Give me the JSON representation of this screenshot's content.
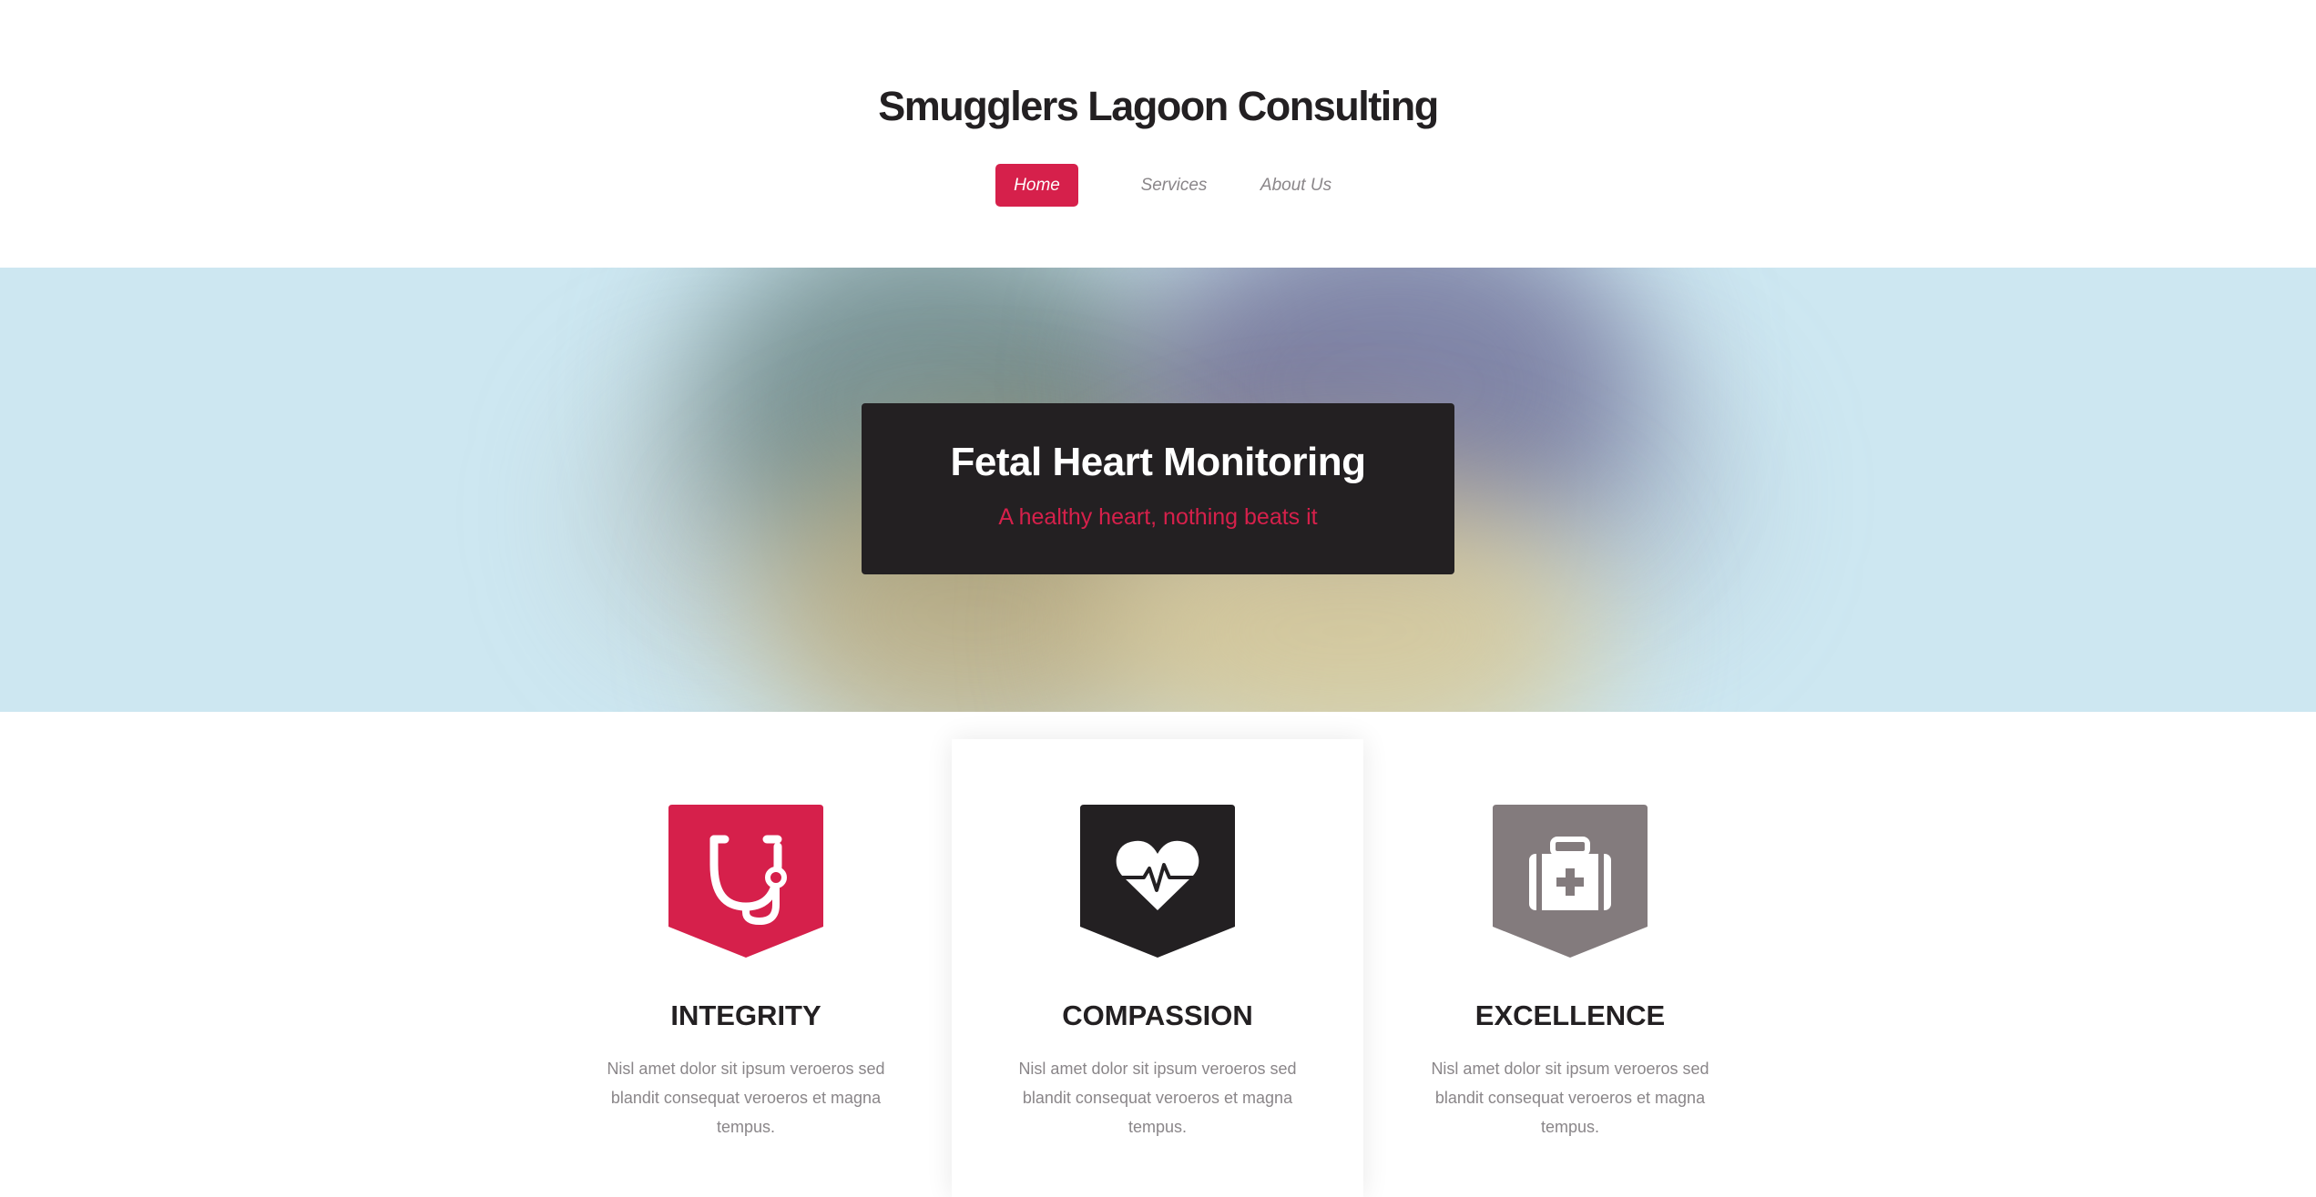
{
  "site": {
    "title": "Smugglers Lagoon Consulting"
  },
  "nav": {
    "items": [
      {
        "label": "Home",
        "active": true
      },
      {
        "label": "Services",
        "active": false
      },
      {
        "label": "About Us",
        "active": false
      }
    ]
  },
  "banner": {
    "title": "Fetal Heart Monitoring",
    "subtitle": "A healthy heart, nothing beats it"
  },
  "features": [
    {
      "title": "INTEGRITY",
      "text": "Nisl amet dolor sit ipsum veroeros sed blandit consequat veroeros et magna tempus.",
      "icon": "stethoscope-icon",
      "color": "#d6204b"
    },
    {
      "title": "COMPASSION",
      "text": "Nisl amet dolor sit ipsum veroeros sed blandit consequat veroeros et magna tempus.",
      "icon": "heartbeat-icon",
      "color": "#232022"
    },
    {
      "title": "EXCELLENCE",
      "text": "Nisl amet dolor sit ipsum veroeros sed blandit consequat veroeros et magna tempus.",
      "icon": "medkit-icon",
      "color": "#837b7d"
    }
  ],
  "colors": {
    "accent": "#d6204b",
    "dark": "#232022",
    "muted": "#837b7d",
    "banner_bg": "#cde7f1"
  }
}
